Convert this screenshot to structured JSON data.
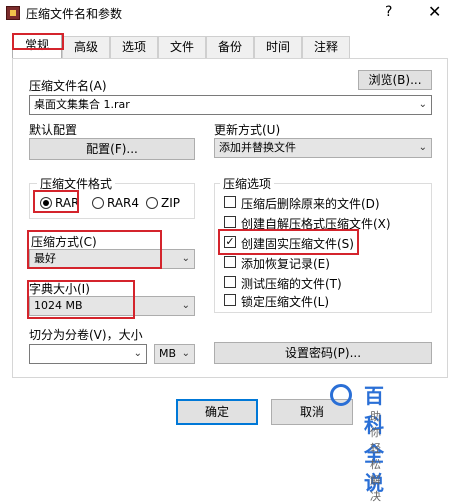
{
  "window": {
    "title": "压缩文件名和参数",
    "help_glyph": "?",
    "close_glyph": "✕"
  },
  "tabs": [
    "常规",
    "高级",
    "选项",
    "文件",
    "备份",
    "时间",
    "注释"
  ],
  "archive_name": {
    "label": "压缩文件名(A)",
    "value": "桌面文集集合 1.rar",
    "browse_label": "浏览(B)..."
  },
  "default_profile": {
    "label": "默认配置",
    "button": "配置(F)..."
  },
  "update_mode": {
    "label": "更新方式(U)",
    "value": "添加并替换文件"
  },
  "format": {
    "label": "压缩文件格式",
    "options": [
      "RAR",
      "RAR4",
      "ZIP"
    ],
    "selected": "RAR"
  },
  "method": {
    "label": "压缩方式(C)",
    "value": "最好"
  },
  "dict_size": {
    "label": "字典大小(I)",
    "value": "1024 MB"
  },
  "split": {
    "label": "切分为分卷(V)，大小",
    "value": "",
    "unit": "MB"
  },
  "options": {
    "label": "压缩选项",
    "items": [
      {
        "label": "压缩后删除原来的文件(D)",
        "checked": false
      },
      {
        "label": "创建自解压格式压缩文件(X)",
        "checked": false
      },
      {
        "label": "创建固实压缩文件(S)",
        "checked": true
      },
      {
        "label": "添加恢复记录(E)",
        "checked": false
      },
      {
        "label": "测试压缩的文件(T)",
        "checked": false
      },
      {
        "label": "锁定压缩文件(L)",
        "checked": false
      }
    ]
  },
  "password_button": "设置密码(P)...",
  "ok_button": "确定",
  "cancel_button": "取消",
  "watermark": {
    "main": "百科全说",
    "sub": "助你轻松解决"
  },
  "colors": {
    "highlight": "#d4242c",
    "watermark": "#2a6fd6"
  }
}
